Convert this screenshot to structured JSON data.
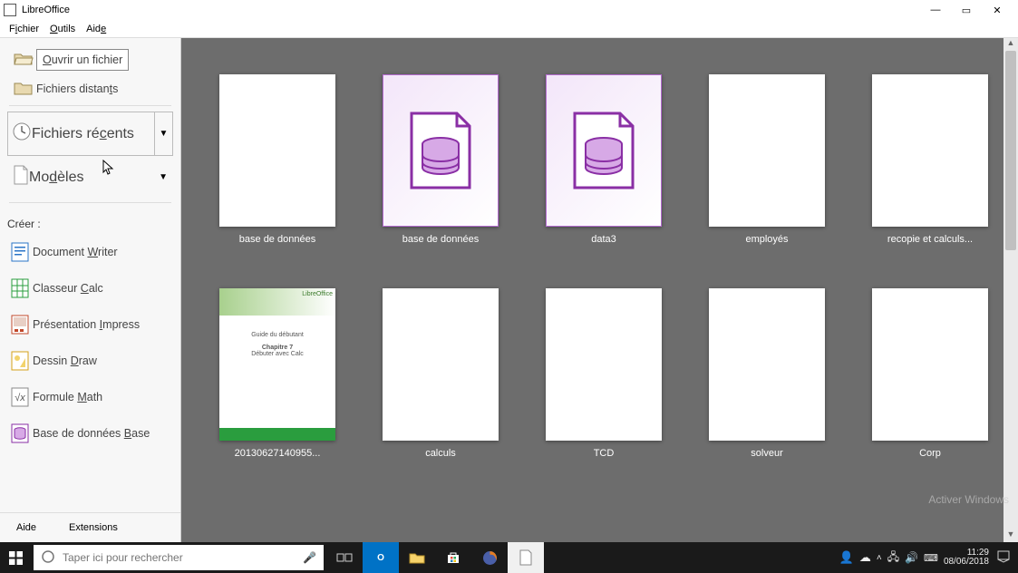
{
  "titlebar": {
    "title": "LibreOffice"
  },
  "menubar": {
    "file_pre": "F",
    "file_u": "i",
    "file_post": "chier",
    "tools_pre": "",
    "tools_u": "O",
    "tools_post": "utils",
    "help_pre": "Aid",
    "help_u": "e",
    "help_post": ""
  },
  "sidebar": {
    "open_pre": "",
    "open_u": "O",
    "open_post": "uvrir un fichier",
    "remote_pre": "Fichiers distan",
    "remote_u": "t",
    "remote_post": "s",
    "recent_pre": "Fichiers ré",
    "recent_u": "c",
    "recent_post": "ents",
    "templates_pre": "Mo",
    "templates_u": "d",
    "templates_post": "èles",
    "create": "Créer :",
    "writer_pre": "Document ",
    "writer_u": "W",
    "writer_post": "riter",
    "calc_pre": "Classeur ",
    "calc_u": "C",
    "calc_post": "alc",
    "impress_pre": "Présentation ",
    "impress_u": "I",
    "impress_post": "mpress",
    "draw_pre": "Dessin ",
    "draw_u": "D",
    "draw_post": "raw",
    "math_pre": "Formule ",
    "math_u": "M",
    "math_post": "ath",
    "base_pre": "Base de données ",
    "base_u": "B",
    "base_post": "ase",
    "help": "Aide",
    "extensions": "Extensions"
  },
  "thumbs": [
    {
      "name": "base de données",
      "kind": "sheet"
    },
    {
      "name": "base de données",
      "kind": "base"
    },
    {
      "name": "data3",
      "kind": "base"
    },
    {
      "name": "employés",
      "kind": "sheet"
    },
    {
      "name": "recopie et calculs...",
      "kind": "sheet"
    },
    {
      "name": "20130627140955...",
      "kind": "guide"
    },
    {
      "name": "calculs",
      "kind": "sheet"
    },
    {
      "name": "TCD",
      "kind": "sheet"
    },
    {
      "name": "solveur",
      "kind": "sheet"
    },
    {
      "name": "Corp",
      "kind": "sheet"
    }
  ],
  "watermark": {
    "line1": "Activer Windows"
  },
  "taskbar": {
    "search_placeholder": "Taper ici pour rechercher",
    "time": "11:29",
    "date": "08/06/2018"
  }
}
